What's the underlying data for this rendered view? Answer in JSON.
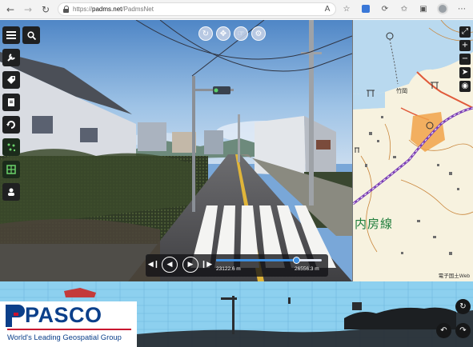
{
  "browser": {
    "url_scheme": "https://",
    "url_host": "padms.net",
    "url_path": "/PadmsNet",
    "nav": {
      "back_icon": "arrow-left-icon",
      "forward_icon": "arrow-right-icon",
      "reload_icon": "reload-icon"
    }
  },
  "street_view": {
    "playback": {
      "start_distance": "23122.6 m",
      "end_distance": "26556.3 m",
      "progress": 0.76
    }
  },
  "map": {
    "line_label": "内房線",
    "place_label": "竹岡",
    "credit": "電子国土Web"
  },
  "logo": {
    "wordmark": "PASCO",
    "tagline": "World's Leading Geospatial Group"
  },
  "colors": {
    "accent_blue": "#3d8fe0",
    "toolbar_dark": "#1f2021",
    "rail_purple": "#7b3fb5",
    "brand_navy": "#0b3f8a",
    "brand_red": "#c8102e",
    "profile_sky": "#8dd0ef"
  }
}
